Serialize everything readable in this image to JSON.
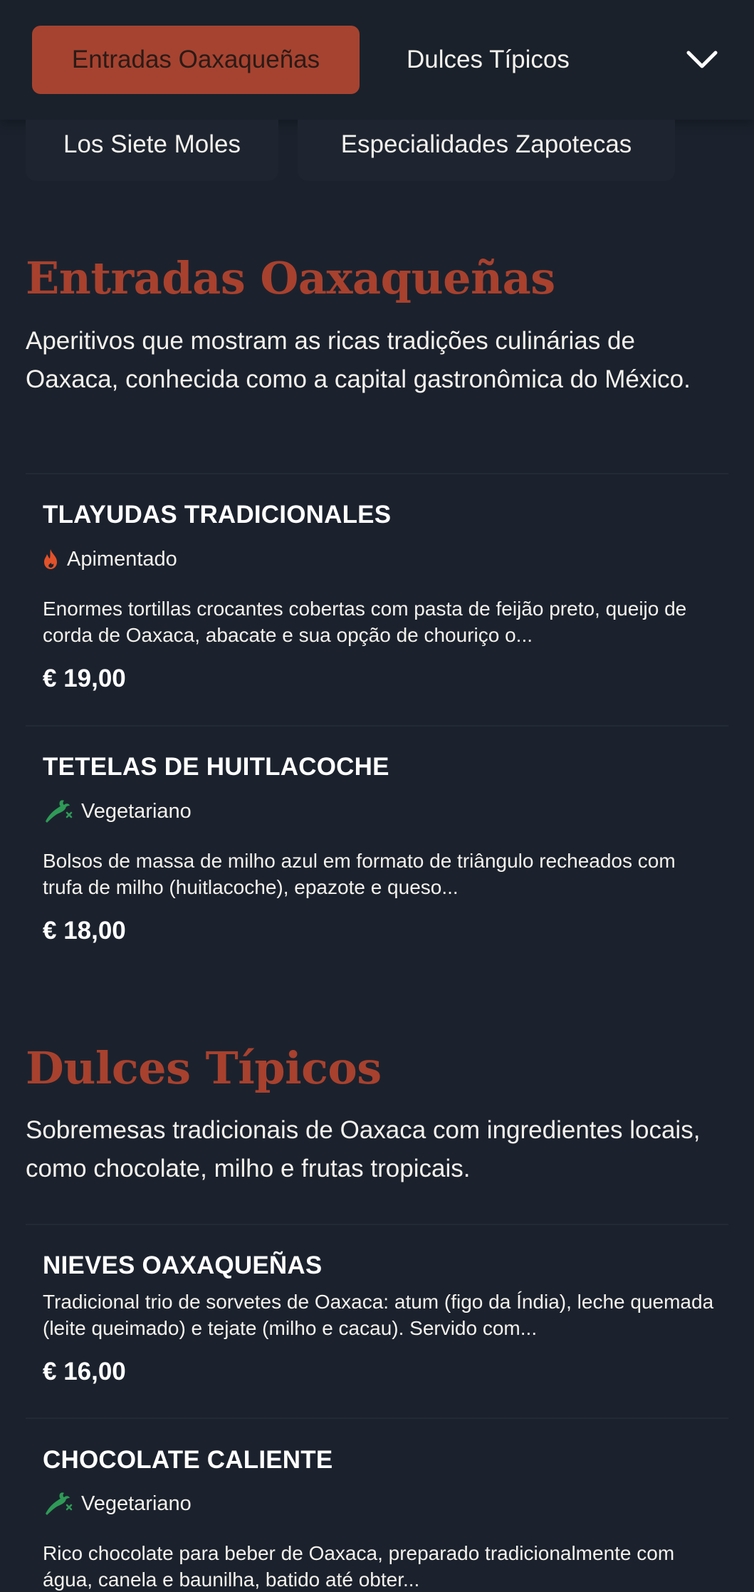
{
  "nav": {
    "tabs": [
      {
        "label": "Entradas Oaxaqueñas",
        "active": true
      },
      {
        "label": "Dulces Típicos",
        "active": false
      }
    ],
    "chips": [
      {
        "label": "Los Siete Moles"
      },
      {
        "label": "Especialidades Zapotecas"
      }
    ],
    "more_icon": "chevron-down-icon"
  },
  "colors": {
    "accent": "#a64330",
    "background": "#1b222d",
    "spicy": "#e2522a",
    "vegetarian": "#2f9a57"
  },
  "sections": [
    {
      "title": "Entradas Oaxaqueñas",
      "description": "Aperitivos que mostram as ricas tradições culinárias de Oaxaca, conhecida como a capital gastronômica do México.",
      "items": [
        {
          "name": "TLAYUDAS TRADICIONALES",
          "tag": "Apimentado",
          "tag_icon": "flame-icon",
          "description": "Enormes tortillas crocantes cobertas com pasta de feijão preto, queijo de corda de Oaxaca, abacate e sua opção de chouriço o...",
          "price": "€ 19,00"
        },
        {
          "name": "TETELAS DE HUITLACOCHE",
          "tag": "Vegetariano",
          "tag_icon": "vegetable-icon",
          "description": "Bolsos de massa de milho azul em formato de triângulo recheados com trufa de milho (huitlacoche), epazote e queso...",
          "price": "€ 18,00"
        }
      ]
    },
    {
      "title": "Dulces Típicos",
      "description": "Sobremesas tradicionais de Oaxaca com ingredientes locais, como chocolate, milho e frutas tropicais.",
      "items": [
        {
          "name": "NIEVES OAXAQUEÑAS",
          "description": "Tradicional trio de sorvetes de Oaxaca: atum (figo da Índia), leche quemada (leite queimado) e tejate (milho e cacau). Servido com...",
          "price": "€ 16,00"
        },
        {
          "name": "CHOCOLATE CALIENTE",
          "tag": "Vegetariano",
          "tag_icon": "vegetable-icon",
          "description": "Rico chocolate para beber de Oaxaca, preparado tradicionalmente com água, canela e baunilha, batido até obter..."
        }
      ]
    }
  ]
}
